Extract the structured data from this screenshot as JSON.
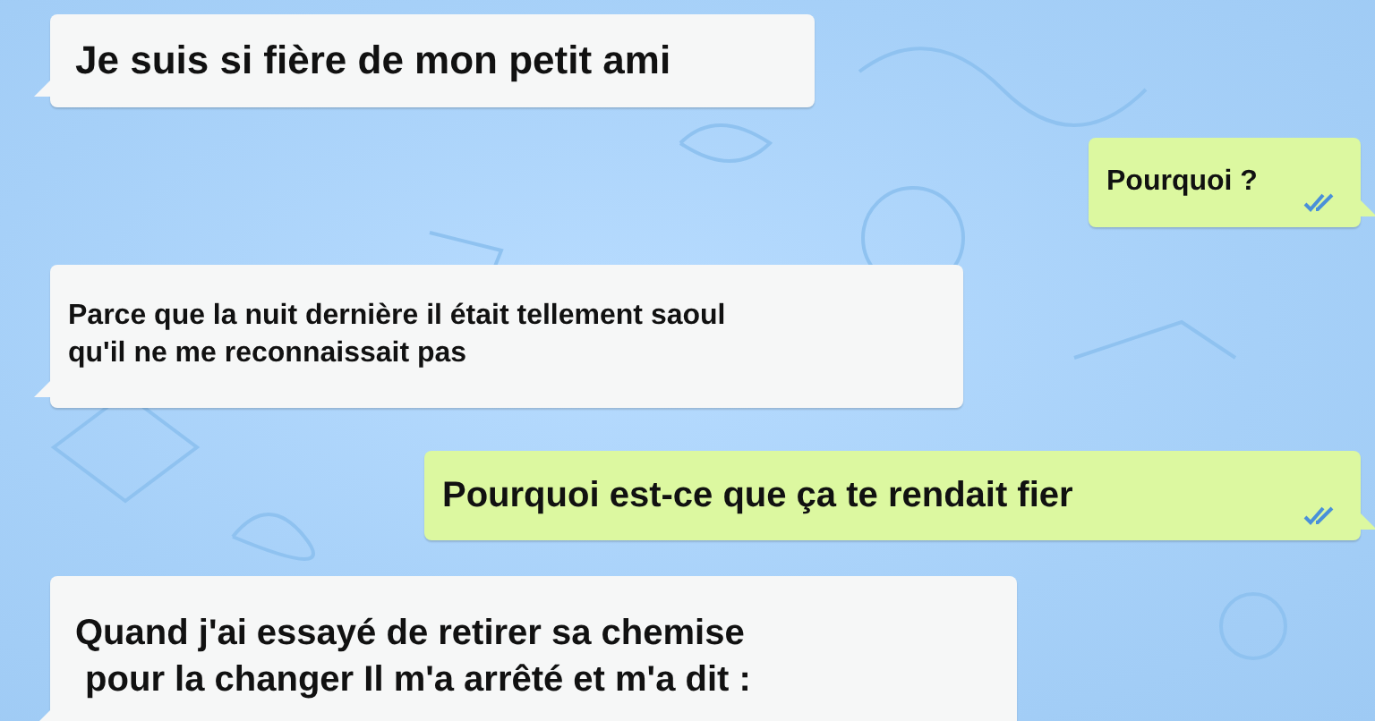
{
  "messages": [
    {
      "kind": "incoming",
      "lines": [
        "Je suis si fière de mon petit ami"
      ]
    },
    {
      "kind": "outgoing",
      "lines": [
        "Pourquoi ?"
      ],
      "read": true
    },
    {
      "kind": "incoming",
      "lines": [
        "Parce que la nuit dernière il était tellement saoul",
        "qu'il ne me reconnaissait pas"
      ]
    },
    {
      "kind": "outgoing",
      "lines": [
        "Pourquoi est-ce que ça te rendait fier"
      ],
      "read": true
    },
    {
      "kind": "incoming",
      "lines": [
        "Quand j'ai essayé de retirer sa chemise",
        " pour la changer Il m'a arrêté et m'a dit :"
      ]
    }
  ]
}
